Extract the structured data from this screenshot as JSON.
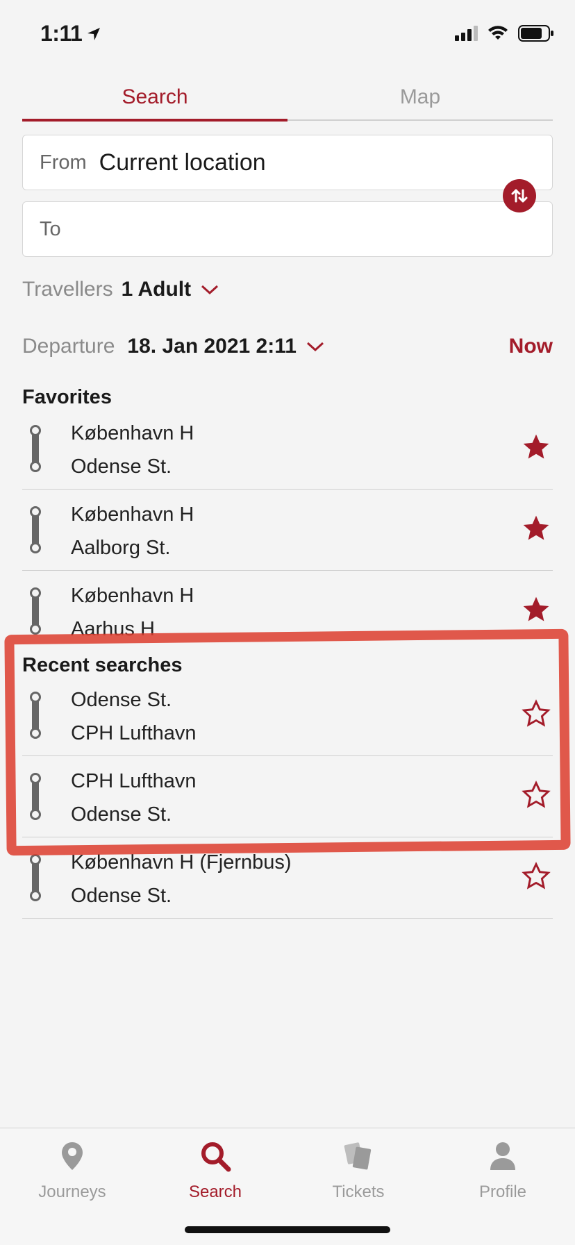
{
  "status": {
    "time": "1:11"
  },
  "tabs": [
    {
      "label": "Search"
    },
    {
      "label": "Map"
    }
  ],
  "from": {
    "label": "From",
    "value": "Current location"
  },
  "to": {
    "label": "To",
    "value": ""
  },
  "travellers": {
    "label": "Travellers",
    "value": "1 Adult"
  },
  "departure": {
    "label": "Departure",
    "value": "18. Jan 2021 2:11",
    "now_label": "Now"
  },
  "favorites": {
    "title": "Favorites",
    "items": [
      {
        "from": "København H",
        "to": "Odense St."
      },
      {
        "from": "København H",
        "to": "Aalborg St."
      },
      {
        "from": "København H",
        "to": "Aarhus H"
      }
    ]
  },
  "recent": {
    "title": "Recent searches",
    "items": [
      {
        "from": "Odense St.",
        "to": "CPH Lufthavn"
      },
      {
        "from": "CPH Lufthavn",
        "to": "Odense St."
      },
      {
        "from": "København H (Fjernbus)",
        "to": "Odense St."
      }
    ]
  },
  "tabbar": [
    {
      "label": "Journeys",
      "icon": "map-pin-icon"
    },
    {
      "label": "Search",
      "icon": "search-icon"
    },
    {
      "label": "Tickets",
      "icon": "tickets-icon"
    },
    {
      "label": "Profile",
      "icon": "person-icon"
    }
  ],
  "colors": {
    "accent": "#a31c2a",
    "highlight": "#dc3c2d"
  }
}
